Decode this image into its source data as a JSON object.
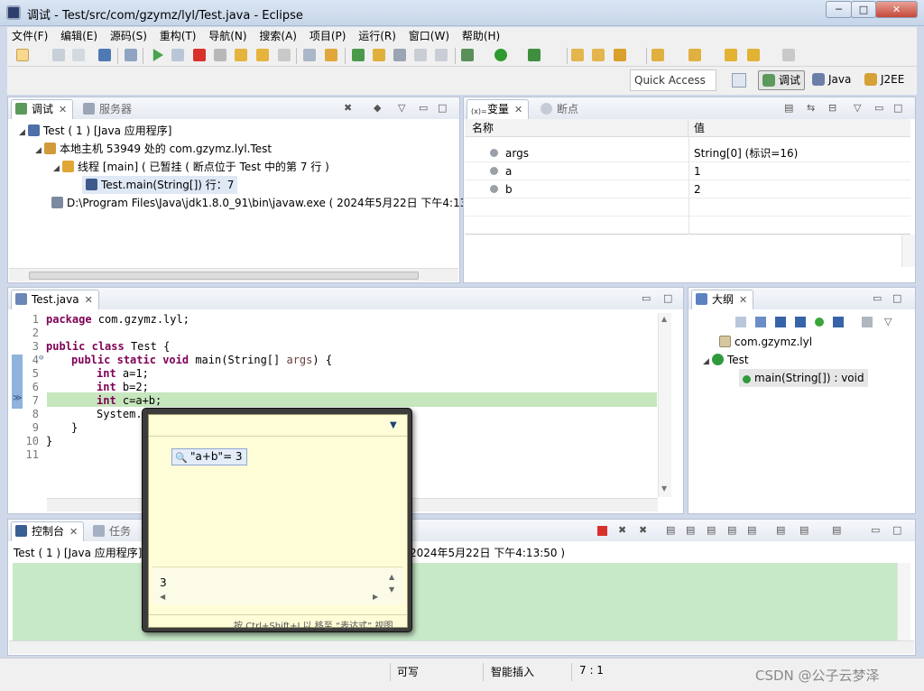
{
  "window": {
    "title": "调试 - Test/src/com/gzymz/lyl/Test.java - Eclipse",
    "minimize": "─",
    "maximize": "□",
    "close": "✕"
  },
  "menu": [
    "文件(F)",
    "编辑(E)",
    "源码(S)",
    "重构(T)",
    "导航(N)",
    "搜索(A)",
    "项目(P)",
    "运行(R)",
    "窗口(W)",
    "帮助(H)"
  ],
  "perspective": {
    "quick_access": "Quick Access",
    "items": [
      "调试",
      "Java",
      "J2EE"
    ]
  },
  "debug_view": {
    "tabs": [
      "调试",
      "服务器"
    ],
    "tree": [
      "Test ( 1 ) [Java 应用程序]",
      "本地主机 53949 处的 com.gzymz.lyl.Test",
      "线程 [main] ( 已暂挂 ( 断点位于 Test 中的第 7 行 )",
      "Test.main(String[]) 行：7",
      "D:\\Program Files\\Java\\jdk1.8.0_91\\bin\\javaw.exe ( 2024年5月22日 下午4:13:"
    ]
  },
  "variables_view": {
    "tabs": [
      "变量",
      "断点"
    ],
    "columns": [
      "名称",
      "值"
    ],
    "rows": [
      {
        "name": "args",
        "value": "String[0]  (标识=16)"
      },
      {
        "name": "a",
        "value": "1"
      },
      {
        "name": "b",
        "value": "2"
      }
    ]
  },
  "editor": {
    "tab": "Test.java",
    "line_numbers": [
      "1",
      "2",
      "3",
      "4",
      "5",
      "6",
      "7",
      "8",
      "9",
      "10",
      "11"
    ],
    "code": {
      "l1_kw": "package",
      "l1_rest": " com.gzymz.lyl;",
      "l3_kw1": "public",
      "l3_kw2": "class",
      "l3_rest": " Test {",
      "l4_kw1": "public",
      "l4_kw2": "static",
      "l4_kw3": "void",
      "l4_rest": " main(String[] ",
      "l4_param": "args",
      "l4_end": ") {",
      "l5_kw": "int",
      "l5_rest": " a=1;",
      "l6_kw": "int",
      "l6_rest": " b=2;",
      "l7_kw": "int",
      "l7_rest": " c=a+b;",
      "l8": "System.",
      "l9": "}",
      "l10": "}"
    },
    "current_line": 7
  },
  "outline_view": {
    "tab": "大纲",
    "items": [
      "com.gzymz.lyl",
      "Test",
      "main(String[]) : void"
    ]
  },
  "console_view": {
    "tabs": [
      "控制台",
      "任务"
    ],
    "header_left": "Test ( 1 ) [Java 应用程序]",
    "header_right": "2024年5月22日 下午4:13:50 )"
  },
  "hover_popup": {
    "expression": "\"a+b\"= 3",
    "value": "3",
    "hint": "按 Ctrl+Shift+I 以 移至 “表达式” 视图"
  },
  "statusbar": {
    "writable": "可写",
    "insert_mode": "智能插入",
    "position": "7 : 1"
  },
  "watermark": "CSDN @公子云梦泽"
}
